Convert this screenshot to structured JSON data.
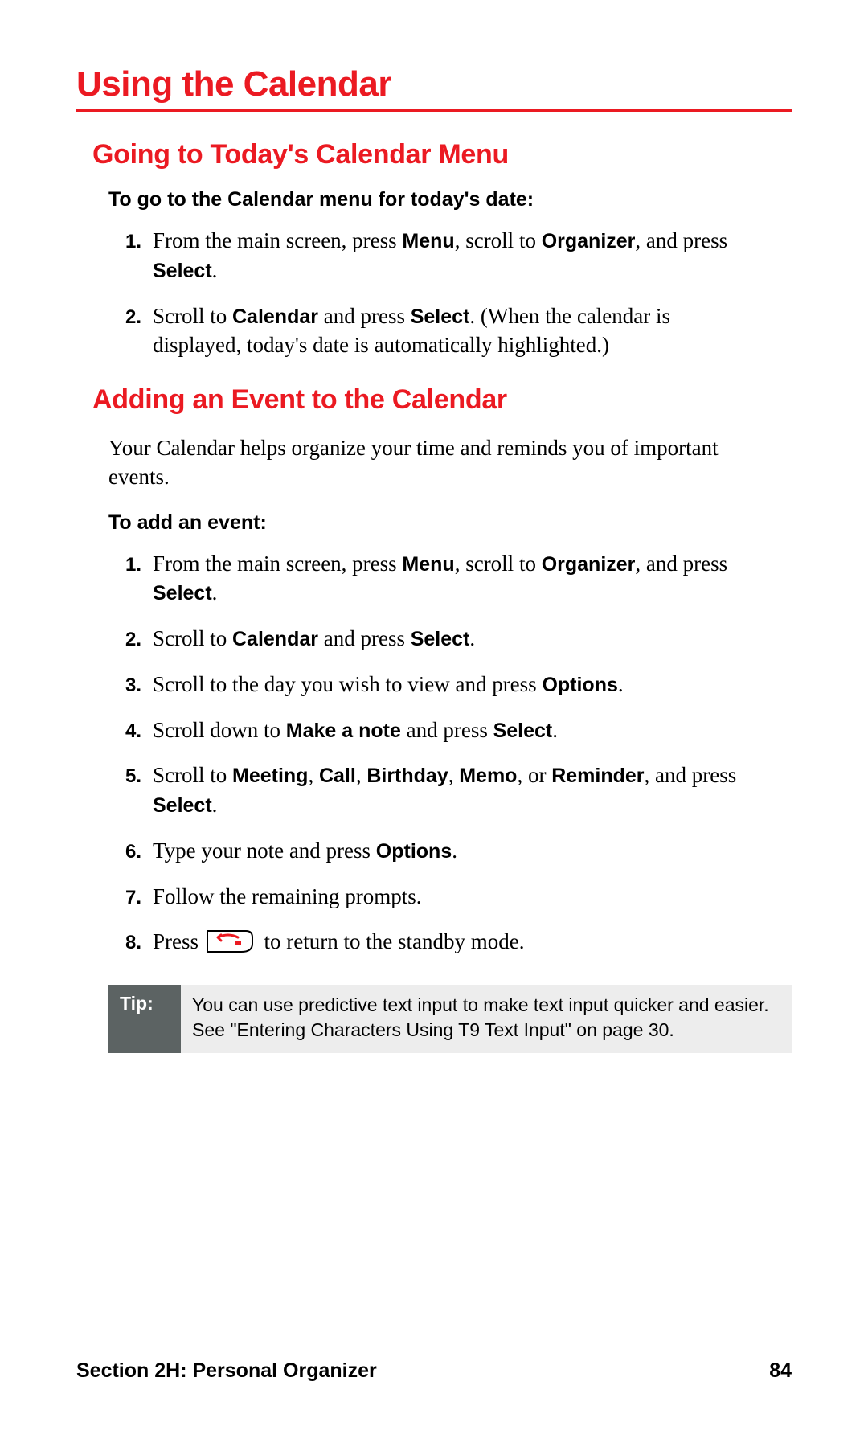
{
  "title": "Using the Calendar",
  "section1": {
    "heading": "Going to Today's Calendar Menu",
    "lead": "To go to the Calendar menu for today's date:",
    "steps_num": [
      "1.",
      "2."
    ],
    "steps_html": [
      "From the main screen, press <b>Menu</b>, scroll to <b>Organizer</b>, and press <b>Select</b>.",
      "Scroll to <b>Calendar</b> and press <b>Select</b>. (When the calendar is displayed, today's date is automatically highlighted.)"
    ]
  },
  "section2": {
    "heading": "Adding an Event to the Calendar",
    "intro": "Your Calendar helps organize your time and reminds you of important events.",
    "lead": "To add an event:",
    "steps_num": [
      "1.",
      "2.",
      "3.",
      "4.",
      "5.",
      "6.",
      "7.",
      "8."
    ],
    "steps_html": [
      "From the main screen, press <b>Menu</b>, scroll to <b>Organizer</b>, and press <b>Select</b>.",
      "Scroll to <b>Calendar</b> and press <b>Select</b>.",
      "Scroll to the day you wish to view and press <b>Options</b>.",
      "Scroll down to <b>Make a note</b> and press <b>Select</b>.",
      "Scroll to <b>Meeting</b>, <b>Call</b>, <b>Birthday</b>, <b>Memo</b>, or <b>Reminder</b>, and press <b>Select</b>.",
      "Type your note and press <b>Options</b>.",
      "Follow the remaining prompts.",
      "Press <span class='key-icon' data-name='end-key-icon' data-interactable='false'><svg width='60' height='30' viewBox='0 0 60 30'><path d='M2 2 L50 2 Q58 2 58 10 L58 18 Q58 28 44 28 L2 28 Z' fill='#fff' stroke='#000' stroke-width='2'/><path d='M15 10 Q28 4 40 10 M15 10 L19 7 M15 10 L19 14' fill='none' stroke='#eb1a22' stroke-width='3' stroke-linecap='round'/><rect x='36' y='14' width='8' height='6' fill='#eb1a22'/></svg></span> to return to the standby mode."
    ]
  },
  "tip": {
    "label": "Tip:",
    "text": "You can use predictive text input to make text input quicker and easier. See \"Entering Characters Using T9 Text Input\" on page 30."
  },
  "footer": {
    "section": "Section 2H: Personal Organizer",
    "page": "84"
  }
}
